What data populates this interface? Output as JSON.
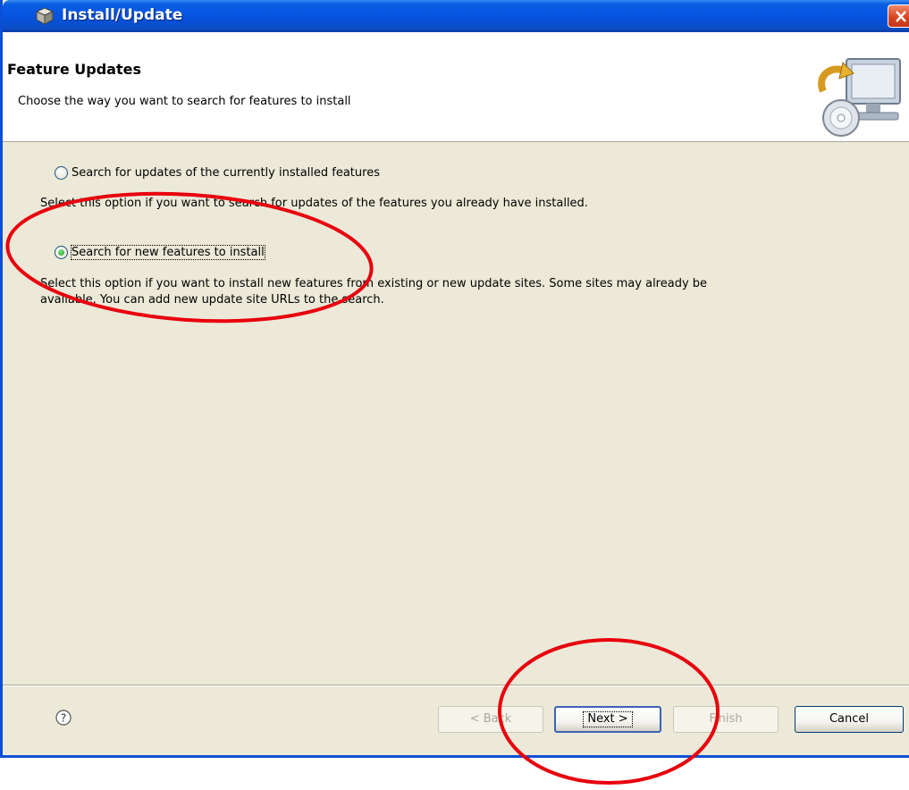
{
  "window": {
    "title": "Install/Update"
  },
  "header": {
    "title": "Feature Updates",
    "description": "Choose the way you want to search for features to install"
  },
  "options": [
    {
      "label": "Search for updates of the currently installed features",
      "description": "Select this option if you want to search for updates of the features you already have installed.",
      "selected": false
    },
    {
      "label": "Search for new features to install",
      "description_line1": "Select this option if you want to install new features from existing or new update sites. Some sites may already be",
      "description_line2": "available. You can add new update site URLs to the search.",
      "selected": true
    }
  ],
  "buttons": {
    "back": "< Back",
    "next": "Next >",
    "finish": "Finish",
    "cancel": "Cancel"
  },
  "colors": {
    "titlebar": "#0554e3",
    "dialog_bg": "#ece9d8",
    "annotation": "#e8000d"
  },
  "icons": {
    "title": "install-update-icon",
    "close": "close-icon",
    "help": "help-icon",
    "header_graphic": "computer-cd-update-icon"
  }
}
